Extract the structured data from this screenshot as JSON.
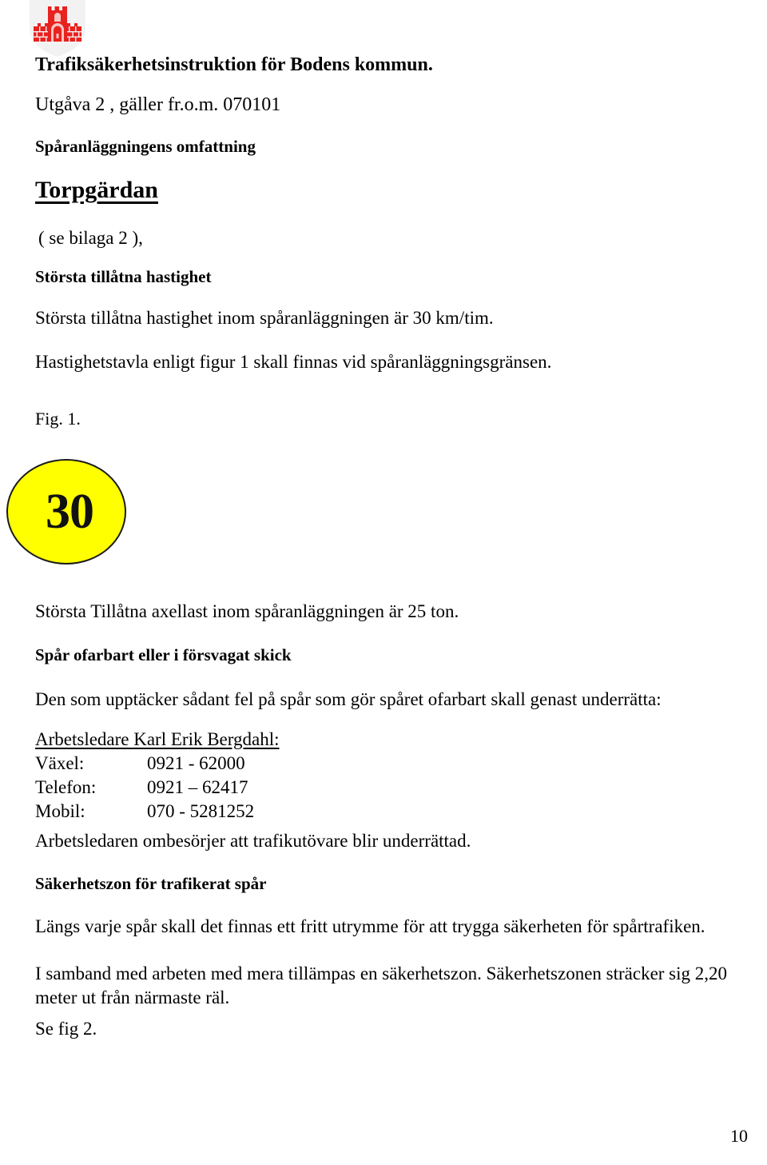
{
  "document": {
    "title": "Trafiksäkerhetsinstruktion för Bodens kommun.",
    "subtitle": "Utgåva 2 , gäller fr.o.m. 070101",
    "page_number": "10"
  },
  "crest": {
    "name": "bodens-kommun-coat-of-arms",
    "shield_color": "#f2f2f2",
    "charge_color": "#e8221f"
  },
  "sections": {
    "omfattning_heading": "Spåranläggningens omfattning",
    "place_name": "Torpgärdan",
    "appendix_note": "( se bilaga 2 ),",
    "speed_heading": "Största tillåtna hastighet",
    "speed_line": "Största tillåtna hastighet inom spåranläggningen är 30 km/tim.",
    "speed_sign_line": "Hastighetstavla enligt figur 1 skall finnas vid spåranläggningsgränsen.",
    "figure_caption": "Fig. 1.",
    "axle_load_line": "Största Tillåtna axellast inom spåranläggningen är 25 ton.",
    "defect_heading": "Spår ofarbart eller i försvagat skick",
    "defect_line": "Den som upptäcker sådant fel på spår som gör spåret ofarbart skall genast underrätta:",
    "foreman_note": "Arbetsledaren ombesörjer att trafikutövare blir underrättad.",
    "safetyzone_heading": "Säkerhetszon för trafikerat spår",
    "safetyzone_line1": "Längs varje spår skall det finnas ett fritt utrymme för att trygga säkerheten för spårtrafiken.",
    "safetyzone_line2": "I samband med arbeten med mera tillämpas en säkerhetszon. Säkerhetszonen sträcker sig 2,20 meter ut från närmaste räl.",
    "see_figure": "Se fig 2."
  },
  "speed_sign": {
    "value": "30",
    "background": "#ffff00",
    "border": "#1a1a1a"
  },
  "contact": {
    "name": "Arbetsledare Karl Erik Bergdahl:",
    "rows": [
      {
        "label": "Växel:",
        "value": "0921 - 62000"
      },
      {
        "label": "Telefon:",
        "value": "0921 – 62417"
      },
      {
        "label": "Mobil:",
        "value": "070 - 5281252"
      }
    ]
  }
}
